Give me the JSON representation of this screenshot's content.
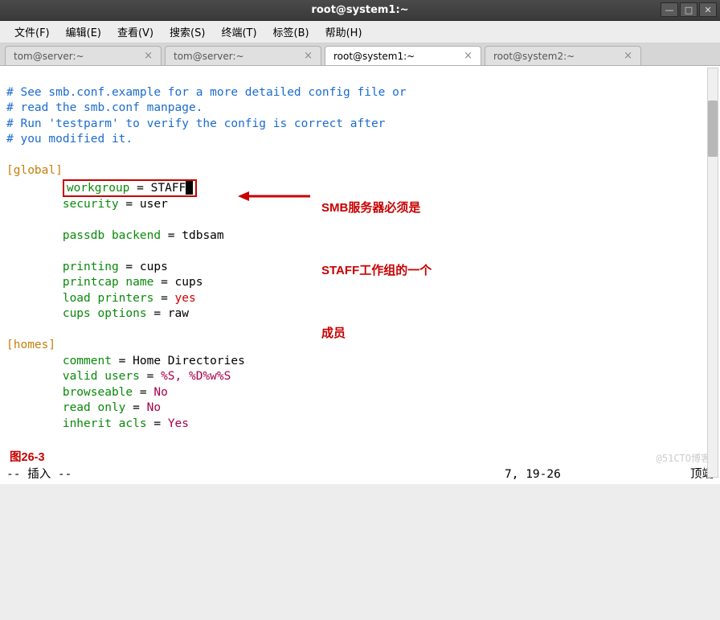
{
  "window": {
    "title": "root@system1:~"
  },
  "menu": {
    "file": "文件(F)",
    "edit": "编辑(E)",
    "view": "查看(V)",
    "search": "搜索(S)",
    "terminal": "终端(T)",
    "tabs": "标签(B)",
    "help": "帮助(H)"
  },
  "tabs": [
    {
      "label": "tom@server:~",
      "active": false
    },
    {
      "label": "tom@server:~",
      "active": false
    },
    {
      "label": "root@system1:~",
      "active": true
    },
    {
      "label": "root@system2:~",
      "active": false
    }
  ],
  "file_content": {
    "comments": [
      "# See smb.conf.example for a more detailed config file or",
      "# read the smb.conf manpage.",
      "# Run 'testparm' to verify the config is correct after",
      "# you modified it."
    ],
    "sections": {
      "global": {
        "workgroup": "STAFF",
        "security": "user",
        "passdb_backend": "tdbsam",
        "printing": "cups",
        "printcap_name": "cups",
        "load_printers": "yes",
        "cups_options": "raw"
      },
      "homes": {
        "comment": "Home Directories",
        "valid_users": "%S, %D%w%S",
        "browseable": "No",
        "read_only": "No",
        "inherit_acls": "Yes"
      }
    }
  },
  "annotation": {
    "line1": "SMB服务器必须是",
    "line2": "STAFF工作组的一个",
    "line3": "成员"
  },
  "figure_label": "图26-3",
  "status": {
    "mode": "-- 插入 --",
    "pos": "7, 19-26",
    "scroll": "顶端"
  },
  "watermark": "@51CTO博客"
}
